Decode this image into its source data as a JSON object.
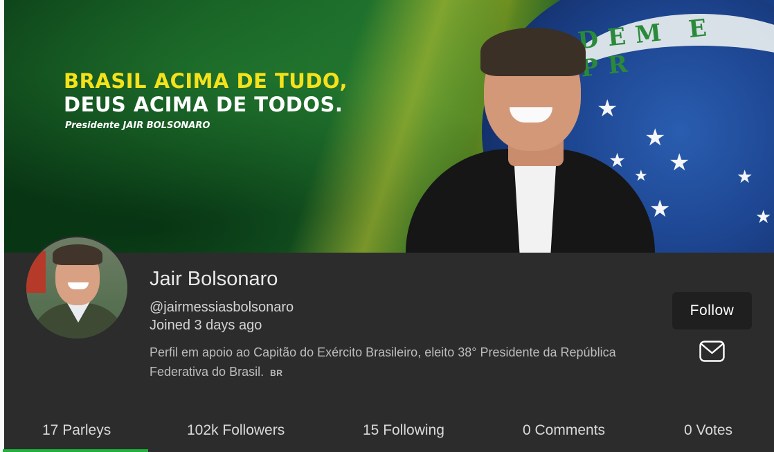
{
  "banner": {
    "headline_line1": "BRASIL ACIMA DE TUDO,",
    "headline_line2": "DEUS ACIMA DE TODOS.",
    "subline": "Presidente JAIR BOLSONARO",
    "flag_ribbon_text": "DEM E PR"
  },
  "profile": {
    "name": "Jair Bolsonaro",
    "handle": "@jairmessiasbolsonaro",
    "joined": "Joined 3 days ago",
    "bio": "Perfil em apoio ao Capitão do Exército Brasileiro, eleito 38° Presidente da República Federativa do Brasil.",
    "bio_flag": "BR",
    "follow_label": "Follow",
    "message_icon": "envelope-icon"
  },
  "tabs": [
    {
      "label": "17 Parleys",
      "active": true
    },
    {
      "label": "102k Followers",
      "active": false
    },
    {
      "label": "15 Following",
      "active": false
    },
    {
      "label": "0 Comments",
      "active": false
    },
    {
      "label": "0 Votes",
      "active": false
    }
  ],
  "colors": {
    "background": "#2c2c2c",
    "accent": "#1fb13c",
    "button_bg": "#1f1f1f",
    "headline_yellow": "#f5e21a"
  }
}
